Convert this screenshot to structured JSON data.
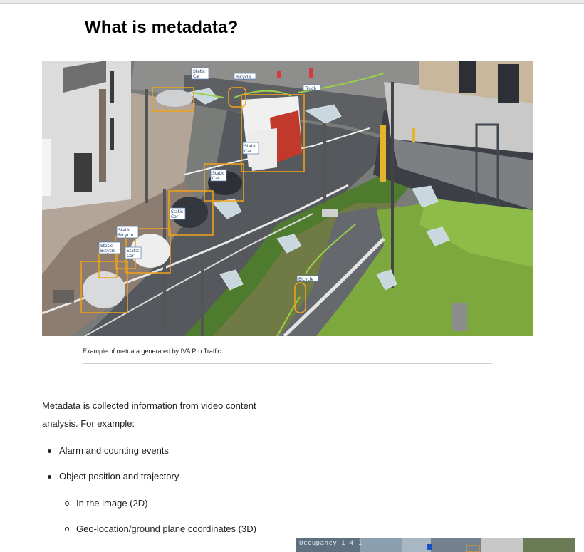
{
  "page": {
    "title": "What is metadata?"
  },
  "figure": {
    "caption": "Example of metdata generated by IVA Pro Traffic",
    "detections": [
      {
        "kind": "car",
        "labels": [
          "Static",
          "Car"
        ]
      },
      {
        "kind": "bicycle",
        "labels": [
          "Bicycle"
        ]
      },
      {
        "kind": "truck",
        "labels": [
          "Truck"
        ]
      },
      {
        "kind": "car",
        "labels": [
          "Static",
          "Car"
        ]
      },
      {
        "kind": "car",
        "labels": [
          "Static",
          "Car"
        ]
      },
      {
        "kind": "car",
        "labels": [
          "Static",
          "Car"
        ]
      },
      {
        "kind": "bicycle",
        "labels": [
          "Static",
          "Bicycle"
        ]
      },
      {
        "kind": "bicycle",
        "labels": [
          "Static",
          "Bicycle"
        ]
      },
      {
        "kind": "car",
        "labels": [
          "Static",
          "Car"
        ]
      },
      {
        "kind": "bicycle",
        "labels": [
          "Bicycle"
        ]
      }
    ],
    "box_color": "#f2a21a",
    "trajectory_color": "#86cc3c"
  },
  "intro": "Metadata is collected information from video content analysis. For example:",
  "list": {
    "alarm": "Alarm and counting events",
    "position": "Object position and trajectory",
    "image_2d": "In the image (2D)",
    "geo_3d": "Geo-location/ground plane coordinates (3D)"
  },
  "thumbnail": {
    "label": "Occupancy 1 4 1"
  }
}
